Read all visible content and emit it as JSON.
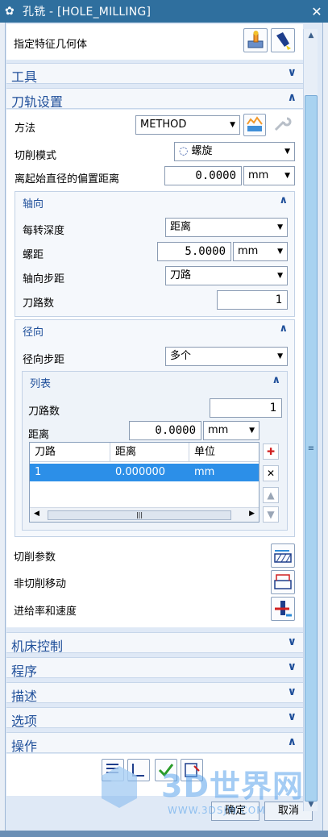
{
  "window": {
    "title": "孔铣 - [HOLE_MILLING]"
  },
  "geometry": {
    "label": "指定特征几何体"
  },
  "sections": {
    "tools": "工具",
    "toolpath": "刀轨设置",
    "machine": "机床控制",
    "program": "程序",
    "describe": "描述",
    "options": "选项",
    "actions": "操作"
  },
  "toolpath": {
    "method_label": "方法",
    "method_value": "METHOD",
    "cut_mode_label": "切削模式",
    "cut_mode_value": "螺旋",
    "offset_label": "离起始直径的偏置距离",
    "offset_value": "0.0000",
    "offset_unit": "mm"
  },
  "axial": {
    "title": "轴向",
    "depth_label": "每转深度",
    "depth_value": "距离",
    "pitch_label": "螺距",
    "pitch_value": "5.0000",
    "pitch_unit": "mm",
    "step_label": "轴向步距",
    "step_value": "刀路",
    "passes_label": "刀路数",
    "passes_value": "1"
  },
  "radial": {
    "title": "径向",
    "step_label": "径向步距",
    "step_value": "多个"
  },
  "list": {
    "title": "列表",
    "passes_label": "刀路数",
    "passes_value": "1",
    "distance_label": "距离",
    "distance_value": "0.0000",
    "distance_unit": "mm",
    "columns": [
      "刀路",
      "距离",
      "单位"
    ],
    "rows": [
      [
        "1",
        "0.000000",
        "mm"
      ]
    ]
  },
  "params": {
    "cut_params": "切削参数",
    "noncut_moves": "非切削移动",
    "feeds_speeds": "进给率和速度"
  },
  "footer": {
    "ok": "确定",
    "cancel": "取消"
  },
  "watermark": {
    "brand": "3D世界网",
    "url": "WWW.3DSJW.COM"
  },
  "colors": {
    "title_bar": "#2f6f9e",
    "accent_text": "#1f4f9a",
    "selection": "#2c8fe8"
  }
}
